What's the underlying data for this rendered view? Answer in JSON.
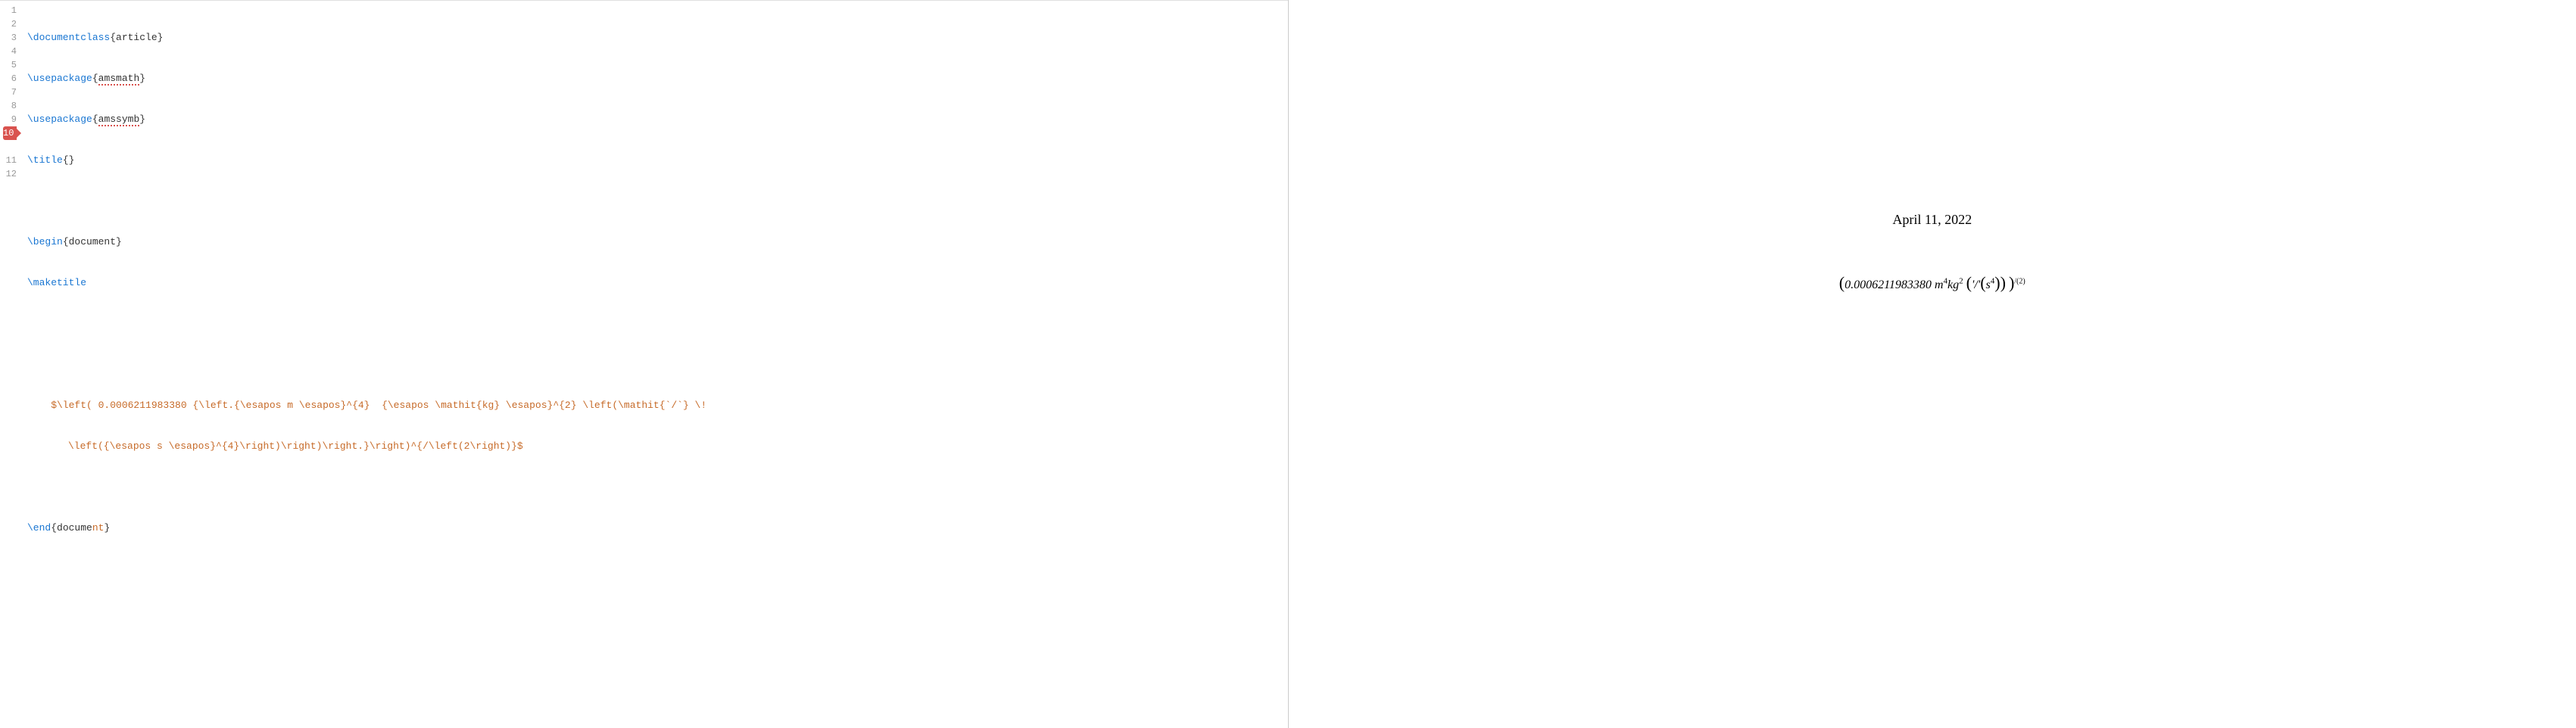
{
  "editor": {
    "lines": [
      {
        "num": "1",
        "error": false
      },
      {
        "num": "2",
        "error": false
      },
      {
        "num": "3",
        "error": false
      },
      {
        "num": "4",
        "error": false
      },
      {
        "num": "5",
        "error": false
      },
      {
        "num": "6",
        "error": false
      },
      {
        "num": "7",
        "error": false
      },
      {
        "num": "8",
        "error": false
      },
      {
        "num": "9",
        "error": false
      },
      {
        "num": "10",
        "error": true
      },
      {
        "num": "",
        "error": false
      },
      {
        "num": "11",
        "error": false
      },
      {
        "num": "12",
        "error": false
      }
    ],
    "line1_cmd": "\\documentclass",
    "line1_arg": "article",
    "line2_cmd": "\\usepackage",
    "line2_arg": "amsmath",
    "line3_cmd": "\\usepackage",
    "line3_arg": "amssymb",
    "line4_cmd": "\\title",
    "line4_arg": "",
    "line6_cmd": "\\begin",
    "line6_arg": "document",
    "line7_cmd": "\\maketitle",
    "line10_a": "    $\\left( 0.0006211983380 {\\left.{\\esapos m \\esapos}^{4}  {\\esapos \\mathit{kg} \\esapos}^{2} \\left(\\mathit{`/`} \\!",
    "line10_b": "\\left({\\esapos s \\esapos}^{4}\\right)\\right)\\right.}\\right)^{/\\left(2\\right)}$",
    "line12_cmd": "\\end",
    "line12_arg_a": "docume",
    "line12_arg_b": "nt"
  },
  "preview": {
    "date": "April 11, 2022",
    "formula_number": "0.0006211983380",
    "formula_m": "m",
    "formula_m_exp": "4",
    "formula_kg": "kg",
    "formula_kg_exp": "2",
    "formula_inner": "'/'",
    "formula_s": "s",
    "formula_s_exp": "4",
    "formula_outer_exp": "/(2)"
  }
}
